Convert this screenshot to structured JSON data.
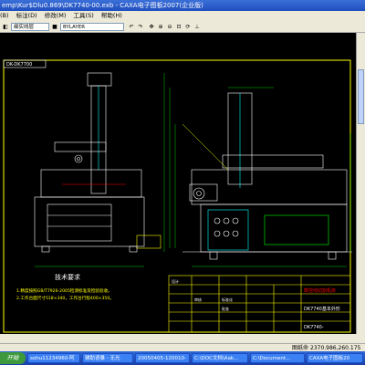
{
  "window": {
    "title": "emp\\Kur$Dlu0.869\\DK7740-00.exb - CAXA电子图板2007(企业版)"
  },
  "menubar": {
    "items": [
      "(B)",
      "标注(D)",
      "修改(M)",
      "工具(S)",
      "帮助(H)"
    ]
  },
  "toolbar": {
    "color_combo": "细实线层",
    "linetype_combo": "BYLAYER"
  },
  "drawing": {
    "corner_label": "DK-DK7700",
    "tech_title": "技术要求",
    "tech_line1": "1.精度按照GB/T7926-2005检测标准及检验验收。",
    "tech_line2": "2.工作台面尺寸518×340，工作台行程400×350。",
    "scale_label": "数控线切割机床",
    "model_label": "DK7740基本外形",
    "model_code": "DK7740-",
    "cell_labels": [
      "设计",
      "标准化",
      "批准",
      "审核"
    ]
  },
  "commandline": {
    "text": ""
  },
  "statusbar": {
    "zoom_label": "图纸命",
    "coords": "2370.986,260.175"
  },
  "taskbar": {
    "start_label": "开始",
    "tasks": [
      "sohu11234960-阿",
      "辅助语暴 - 无光",
      "20050405-120010-",
      "C:\\DOC文档\\Aak...",
      "C:\\Document...",
      "CAXA电子图板20"
    ]
  },
  "colors": {
    "drawing_line": "#ffffff",
    "frame_yellow": "#ffff00",
    "accent_cyan": "#00ffff",
    "dim_green": "#00ff00",
    "red": "#ff0000",
    "magenta": "#ff00ff"
  }
}
